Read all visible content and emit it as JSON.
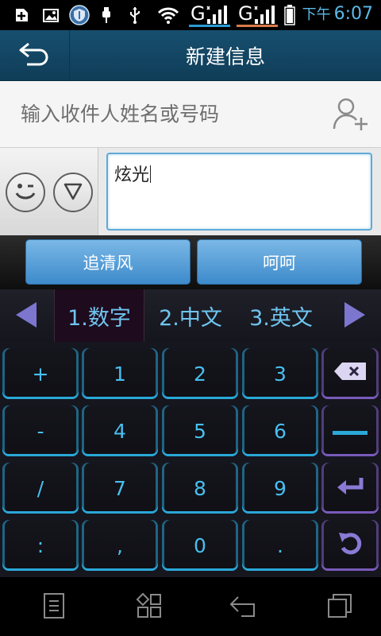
{
  "status_bar": {
    "signal1": "G",
    "signal2": "G",
    "time_ampm": "下午",
    "time": "6:07",
    "icons": [
      "add-icon",
      "gallery-icon",
      "security-shield-icon",
      "battery-saver-icon",
      "usb-icon",
      "wifi-icon",
      "signal-icon",
      "signal-icon",
      "battery-icon"
    ],
    "accent": "#5bb9e8"
  },
  "header": {
    "title": "新建信息",
    "back_icon": "back-arrow-icon"
  },
  "recipient": {
    "placeholder": "输入收件人姓名或号码",
    "add_icon": "add-contact-icon"
  },
  "compose": {
    "text": "炫光",
    "emoji_icon": "smiley-icon",
    "expand_icon": "chevron-down-circle-icon"
  },
  "candidates": [
    "追清风",
    "呵呵"
  ],
  "keyboard": {
    "tabs": [
      "1.数字",
      "2.中文",
      "3.英文"
    ],
    "active_tab": 0,
    "rows": [
      [
        "+",
        "1",
        "2",
        "3"
      ],
      [
        "-",
        "4",
        "5",
        "6"
      ],
      [
        "/",
        "7",
        "8",
        "9"
      ],
      [
        ":",
        ",",
        "0",
        "."
      ]
    ],
    "func_keys": [
      "backspace-icon",
      "space-icon",
      "enter-icon",
      "undo-icon"
    ],
    "key_color": "#48bfee",
    "func_color": "#7a5aba"
  },
  "navbar": {
    "icons": [
      "menu-icon",
      "apps-icon",
      "back-icon",
      "recents-icon"
    ]
  }
}
